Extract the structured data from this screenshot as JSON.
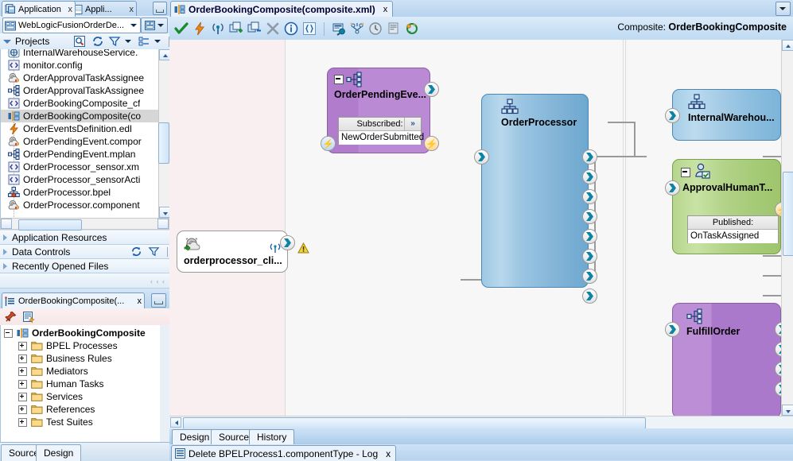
{
  "app_tabs": {
    "selected": {
      "label": "Application",
      "icon": "applications-icon",
      "close": "x"
    },
    "other": {
      "label": "Appli...",
      "icon": "application-icon",
      "close": "x"
    },
    "minimize": "minimize-icon"
  },
  "application_selector": {
    "value": "WebLogicFusionOrderDe...",
    "icon": "application-icon",
    "dropdown": "chevron-down-icon"
  },
  "projects_panel": {
    "title": "Projects",
    "toolbar": [
      "search-icon",
      "refresh-icon",
      "filter-icon",
      "filter-dropdown-icon",
      "view-options-icon",
      "view-dropdown-icon"
    ],
    "items": [
      {
        "label": "InternalWarehouseService.",
        "icon": "wsdl-icon",
        "selected": false
      },
      {
        "label": "monitor.config",
        "icon": "xml-icon",
        "selected": false
      },
      {
        "label": "OrderApprovalTaskAssignee",
        "icon": "component-icon",
        "selected": false
      },
      {
        "label": "OrderApprovalTaskAssignee",
        "icon": "mediator-icon",
        "selected": false
      },
      {
        "label": "OrderBookingComposite_cf",
        "icon": "xml-icon",
        "selected": false
      },
      {
        "label": "OrderBookingComposite(co",
        "icon": "composite-icon",
        "selected": true
      },
      {
        "label": "OrderEventsDefinition.edl",
        "icon": "event-icon",
        "selected": false
      },
      {
        "label": "OrderPendingEvent.compor",
        "icon": "component-icon",
        "selected": false
      },
      {
        "label": "OrderPendingEvent.mplan",
        "icon": "mediator-icon",
        "selected": false
      },
      {
        "label": "OrderProcessor_sensor.xm",
        "icon": "xml-icon",
        "selected": false
      },
      {
        "label": "OrderProcessor_sensorActi",
        "icon": "xml-icon",
        "selected": false
      },
      {
        "label": "OrderProcessor.bpel",
        "icon": "bpel-icon",
        "selected": false
      },
      {
        "label": "OrderProcessor.component",
        "icon": "component-icon",
        "selected": false
      }
    ]
  },
  "collapsed_panels": [
    {
      "label": "Application Resources",
      "icons": []
    },
    {
      "label": "Data Controls",
      "icons": [
        "refresh-icon",
        "filter-icon"
      ]
    },
    {
      "label": "Recently Opened Files",
      "icons": []
    }
  ],
  "structure_panel": {
    "tab_label": "OrderBookingComposite(...",
    "tab_icon": "structure-icon",
    "close": "x",
    "minimize": "minimize-icon",
    "toolbar": [
      "pin-icon",
      "new-icon"
    ],
    "root": {
      "label": "OrderBookingComposite",
      "icon": "composite-icon"
    },
    "children": [
      {
        "label": "BPEL Processes",
        "icon": "folder-icon"
      },
      {
        "label": "Business Rules",
        "icon": "folder-icon"
      },
      {
        "label": "Mediators",
        "icon": "folder-icon"
      },
      {
        "label": "Human Tasks",
        "icon": "folder-icon"
      },
      {
        "label": "Services",
        "icon": "folder-icon"
      },
      {
        "label": "References",
        "icon": "folder-icon"
      },
      {
        "label": "Test Suites",
        "icon": "folder-icon"
      }
    ]
  },
  "left_bottom_tabs": [
    {
      "label": "Source",
      "active": false
    },
    {
      "label": "Design",
      "active": true
    }
  ],
  "editor": {
    "tab": {
      "label": "OrderBookingComposite(composite.xml)",
      "icon": "composite-icon",
      "close": "x"
    },
    "tab_dropdown": "chevron-down-icon",
    "toolbar_icons": [
      "validate-check-icon",
      "lightning-icon",
      "antenna-icon",
      "add-component-icon",
      "remove-component-icon",
      "delete-x-icon",
      "info-icon",
      "xpath-braces-icon",
      "sensor-icon",
      "policy-icon",
      "history-icon",
      "properties-icon",
      "refresh-arrows-icon"
    ],
    "composite_prefix": "Composite:",
    "composite_name": "OrderBookingComposite",
    "bottom_tabs": [
      {
        "label": "Design",
        "active": true
      },
      {
        "label": "Source",
        "active": false
      },
      {
        "label": "History",
        "active": false
      }
    ]
  },
  "log": {
    "tab_label": "Delete BPELProcess1.componentType - Log",
    "icon": "log-icon",
    "close": "x"
  },
  "canvas": {
    "services_lane_color": "#f9eff1",
    "components": [
      {
        "id": "orderprocessor_client",
        "name": "orderprocessor_cli...",
        "kind": "service",
        "icon": "service-gear-icon",
        "badges": [
          "antenna-icon",
          "warning-icon"
        ],
        "color": "#ffffff"
      },
      {
        "id": "orderpendingevent",
        "name": "OrderPendingEve...",
        "kind": "mediator",
        "icon": "mediator-icon",
        "color": "#b98cd4",
        "event_label": "Subscribed:",
        "event_value": "NewOrderSubmitted",
        "more": "»",
        "left_bolt": "blue",
        "right_bolt": "orange"
      },
      {
        "id": "orderprocessor",
        "name": "OrderProcessor",
        "kind": "bpel",
        "icon": "bpel-icon",
        "color": "#7fb4d8",
        "input_ports": 1,
        "output_ports": 8
      },
      {
        "id": "internalwarehouse",
        "name": "InternalWarehou...",
        "kind": "reference",
        "icon": "bpel-icon",
        "color": "#8ec0e3"
      },
      {
        "id": "approvalhumantask",
        "name": "ApprovalHumanT...",
        "kind": "humantask",
        "icon": "humantask-icon",
        "color": "#aed080",
        "event_label": "Published:",
        "event_value": "OnTaskAssigned",
        "right_bolt": "orange"
      },
      {
        "id": "fulfillorder",
        "name": "FulfillOrder",
        "kind": "mediator",
        "icon": "mediator-icon",
        "color": "#b98cd4",
        "input_ports": 1,
        "output_ports": 4
      }
    ]
  }
}
